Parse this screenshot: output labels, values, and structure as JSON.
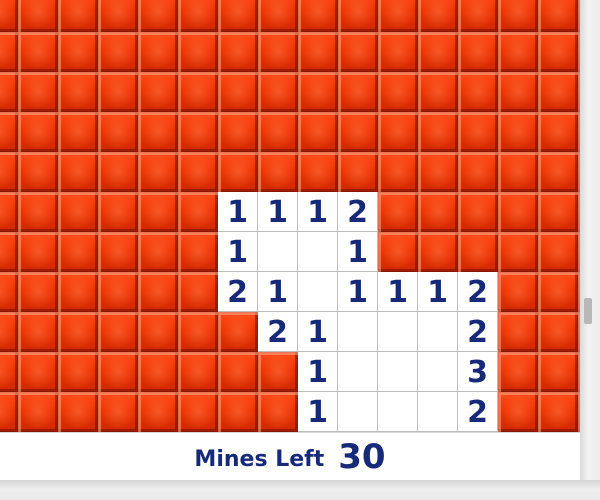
{
  "status": {
    "mines_left_label": "Mines Left",
    "mines_left_value": "30"
  },
  "colors": {
    "tile_covered": "#ee3300",
    "number": "#172a7a",
    "revealed": "#ffffff"
  },
  "board": {
    "cols": 16,
    "rows": 12,
    "legend": "# = covered tile, . = revealed empty, digit = revealed number",
    "rows_data": [
      "################",
      "################",
      "################",
      "################",
      "################",
      "######1112######",
      "######1..1######",
      "######21.1112###",
      "#######21...2###",
      "########1...3###",
      "########1...2###",
      "################"
    ]
  }
}
